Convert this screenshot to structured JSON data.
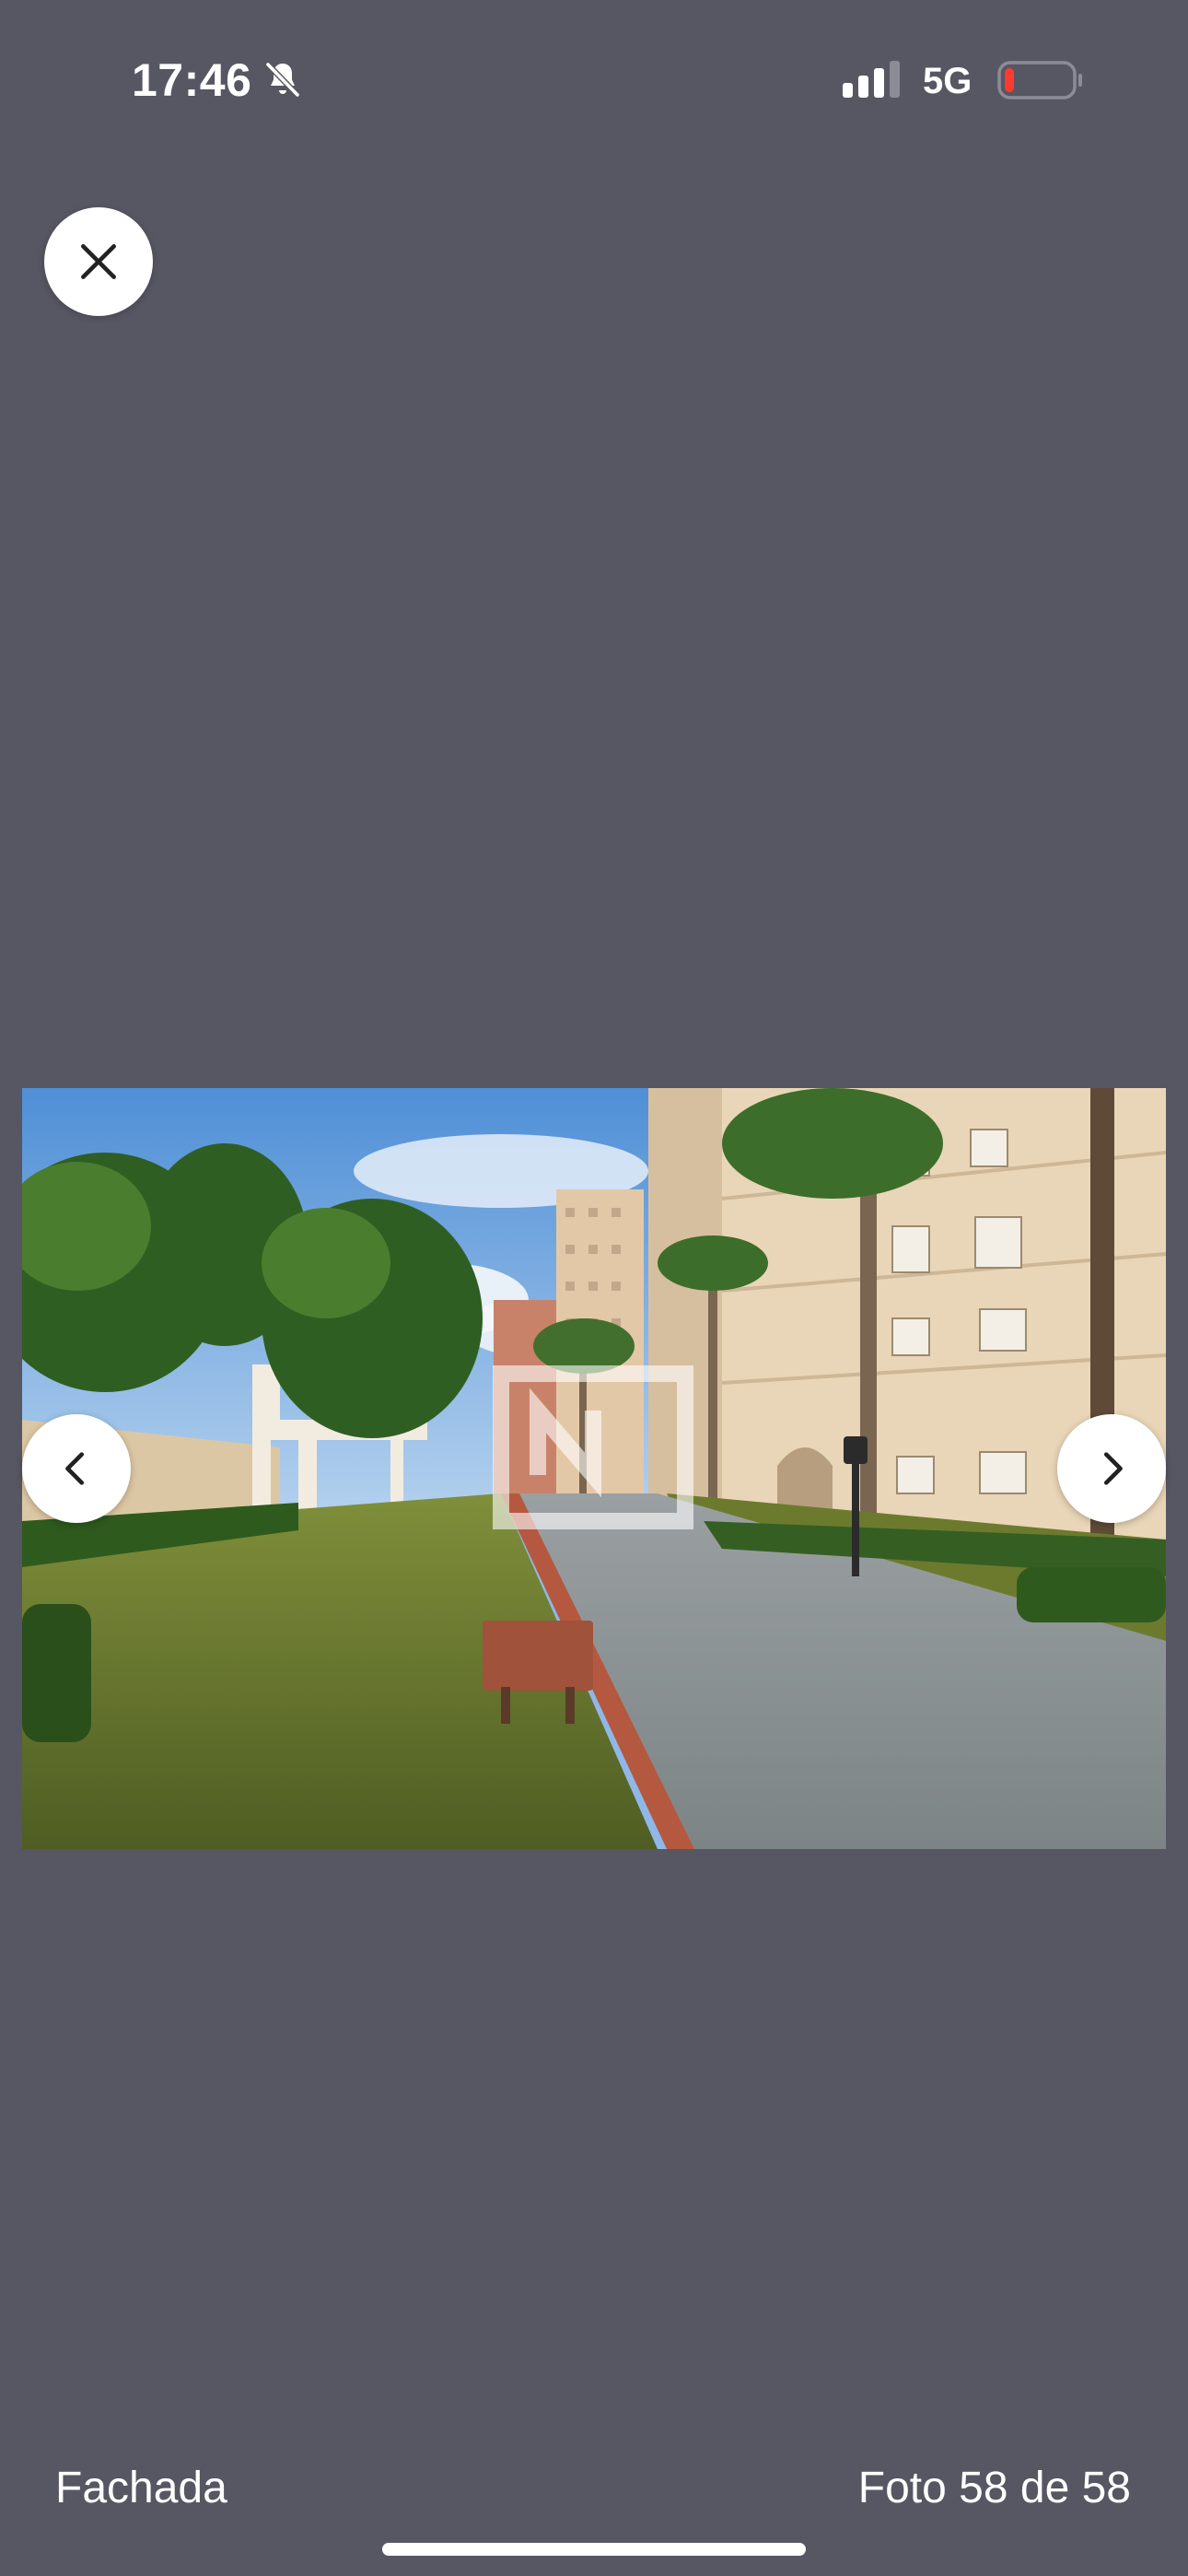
{
  "status_bar": {
    "time": "17:46",
    "network": "5G",
    "icons": [
      "bell-slash-icon",
      "signal-icon",
      "battery-low-icon"
    ],
    "battery_color": "#ff3b30"
  },
  "viewer": {
    "close_icon": "close-icon",
    "prev_icon": "chevron-left-icon",
    "next_icon": "chevron-right-icon",
    "photo_alt": "Fachada"
  },
  "footer": {
    "caption": "Fachada",
    "counter": "Foto 58 de 58"
  },
  "colors": {
    "background": "#575663",
    "button": "#ffffff"
  }
}
